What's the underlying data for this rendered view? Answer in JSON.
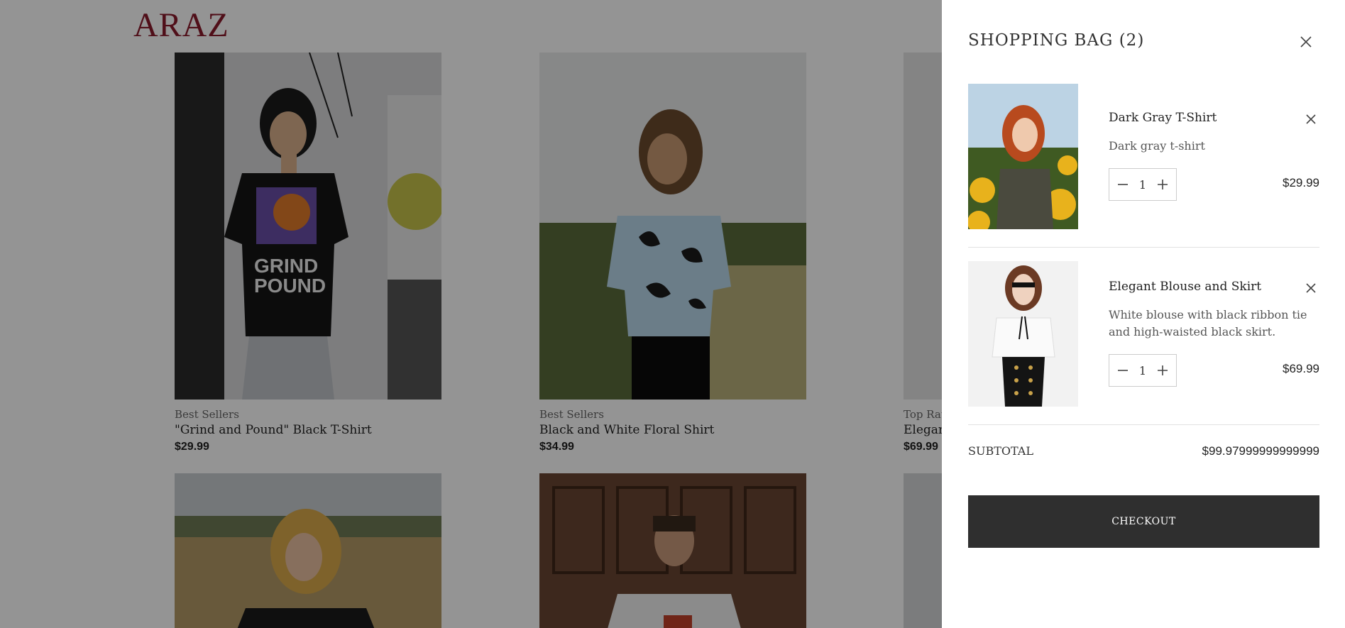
{
  "brand": {
    "logo_text": "ARAZ"
  },
  "products": [
    {
      "category": "Best Sellers",
      "name": "\"Grind and Pound\" Black T-Shirt",
      "price": "$29.99"
    },
    {
      "category": "Best Sellers",
      "name": "Black and White Floral Shirt",
      "price": "$34.99"
    },
    {
      "category": "Top Rate",
      "name": "Elegan",
      "price": "$69.99"
    }
  ],
  "cart": {
    "title": "SHOPPING BAG (2)",
    "items": [
      {
        "name": "Dark Gray T-Shirt",
        "description": "Dark gray t-shirt",
        "quantity": "1",
        "price": "$29.99"
      },
      {
        "name": "Elegant Blouse and Skirt",
        "description": "White blouse with black ribbon tie and high-waisted black skirt.",
        "quantity": "1",
        "price": "$69.99"
      }
    ],
    "subtotal_label": "SUBTOTAL",
    "subtotal_value": "$99.97999999999999",
    "checkout_label": "CHECKOUT"
  },
  "icons": {
    "close": "close-icon",
    "minus": "minus-icon",
    "plus": "plus-icon"
  },
  "colors": {
    "brand": "#8b1a2b",
    "overlay": "rgba(0,0,0,0.42)",
    "checkout_bg": "#2f2f2f"
  }
}
